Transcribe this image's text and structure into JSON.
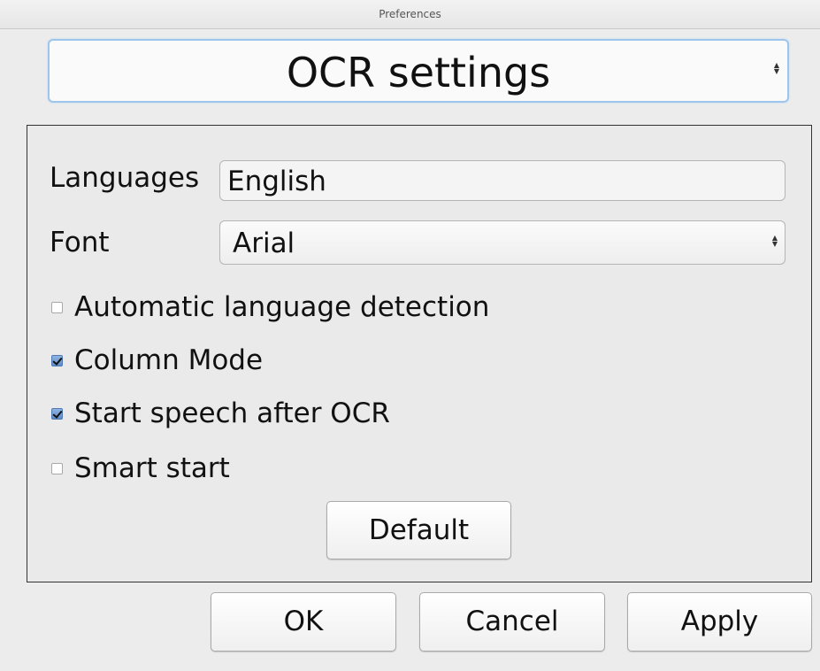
{
  "window": {
    "title": "Preferences"
  },
  "category": {
    "selected": "OCR settings",
    "icon": "updown-arrows-icon"
  },
  "form": {
    "languages_label": "Languages",
    "languages_value": "English",
    "font_label": "Font",
    "font_value": "Arial",
    "font_icon": "updown-arrows-icon"
  },
  "options": [
    {
      "label": "Automatic language detection",
      "checked": false
    },
    {
      "label": "Column Mode",
      "checked": true
    },
    {
      "label": "Start speech after OCR",
      "checked": true
    },
    {
      "label": "Smart start",
      "checked": false
    }
  ],
  "buttons": {
    "default_label": "Default",
    "ok_label": "OK",
    "cancel_label": "Cancel",
    "apply_label": "Apply"
  },
  "colors": {
    "focus_ring": "#9ec6ec",
    "checkbox_checked": "#5e8bc8"
  }
}
